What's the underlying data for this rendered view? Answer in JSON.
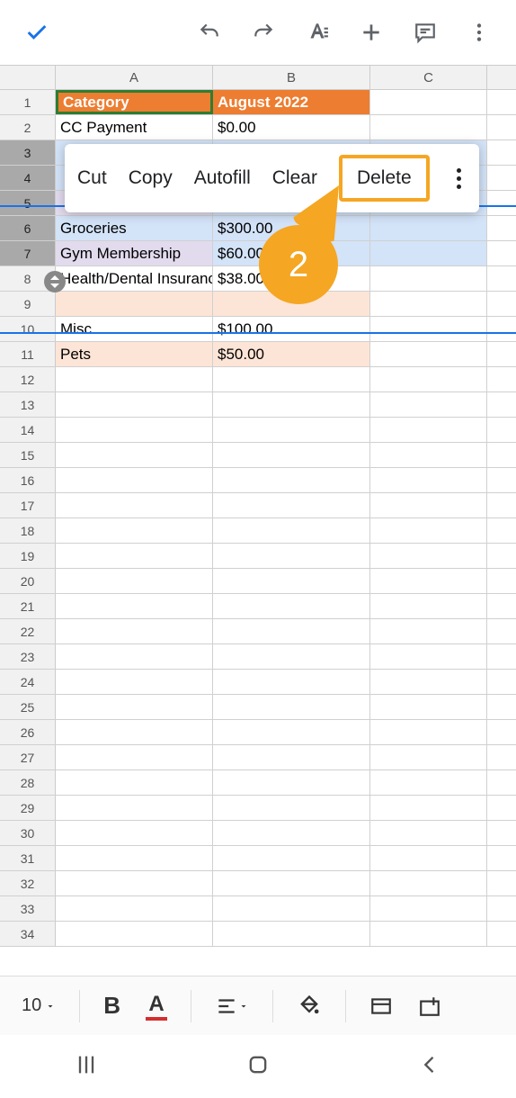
{
  "toolbar": {},
  "columns": [
    "A",
    "B",
    "C"
  ],
  "context_menu": {
    "cut": "Cut",
    "copy": "Copy",
    "autofill": "Autofill",
    "clear": "Clear",
    "delete": "Delete"
  },
  "callout": {
    "number": "2"
  },
  "rows": [
    {
      "n": "1",
      "a": "Category",
      "b": "August 2022",
      "c": "",
      "aCls": "hdr-cell first",
      "bCls": "hdr-cell",
      "cCls": ""
    },
    {
      "n": "2",
      "a": "CC Payment",
      "b": "$0.00",
      "c": "",
      "aCls": "",
      "bCls": "",
      "cCls": ""
    },
    {
      "n": "3",
      "a": "",
      "b": "",
      "c": "",
      "aCls": "blue-sel",
      "bCls": "blue-sel",
      "cCls": "blue-sel",
      "hSel": true
    },
    {
      "n": "4",
      "a": "",
      "b": "",
      "c": "",
      "aCls": "blue-sel",
      "bCls": "blue-sel",
      "cCls": "blue-sel",
      "hSel": true
    },
    {
      "n": "5",
      "a": "",
      "b": "",
      "c": "",
      "aCls": "lav",
      "bCls": "blue-sel",
      "cCls": "blue-sel",
      "hSel": true
    },
    {
      "n": "6",
      "a": "Groceries",
      "b": "$300.00",
      "c": "",
      "aCls": "blue-sel",
      "bCls": "blue-sel",
      "cCls": "blue-sel",
      "hSel": true
    },
    {
      "n": "7",
      "a": "Gym Membership",
      "b": "$60.00",
      "c": "",
      "aCls": "lav",
      "bCls": "blue-sel",
      "cCls": "blue-sel",
      "hSel": true
    },
    {
      "n": "8",
      "a": "Health/Dental Insuranc",
      "b": "$38.00",
      "c": "",
      "aCls": "",
      "bCls": "",
      "cCls": ""
    },
    {
      "n": "9",
      "a": "",
      "b": "",
      "c": "",
      "aCls": "peach",
      "bCls": "peach",
      "cCls": ""
    },
    {
      "n": "10",
      "a": "Misc",
      "b": "$100.00",
      "c": "",
      "aCls": "",
      "bCls": "",
      "cCls": ""
    },
    {
      "n": "11",
      "a": "Pets",
      "b": "$50.00",
      "c": "",
      "aCls": "peach",
      "bCls": "peach",
      "cCls": ""
    },
    {
      "n": "12",
      "a": "",
      "b": "",
      "c": ""
    },
    {
      "n": "13",
      "a": "",
      "b": "",
      "c": ""
    },
    {
      "n": "14",
      "a": "",
      "b": "",
      "c": ""
    },
    {
      "n": "15",
      "a": "",
      "b": "",
      "c": ""
    },
    {
      "n": "16",
      "a": "",
      "b": "",
      "c": ""
    },
    {
      "n": "17",
      "a": "",
      "b": "",
      "c": ""
    },
    {
      "n": "18",
      "a": "",
      "b": "",
      "c": ""
    },
    {
      "n": "19",
      "a": "",
      "b": "",
      "c": ""
    },
    {
      "n": "20",
      "a": "",
      "b": "",
      "c": ""
    },
    {
      "n": "21",
      "a": "",
      "b": "",
      "c": ""
    },
    {
      "n": "22",
      "a": "",
      "b": "",
      "c": ""
    },
    {
      "n": "23",
      "a": "",
      "b": "",
      "c": ""
    },
    {
      "n": "24",
      "a": "",
      "b": "",
      "c": ""
    },
    {
      "n": "25",
      "a": "",
      "b": "",
      "c": ""
    },
    {
      "n": "26",
      "a": "",
      "b": "",
      "c": ""
    },
    {
      "n": "27",
      "a": "",
      "b": "",
      "c": ""
    },
    {
      "n": "28",
      "a": "",
      "b": "",
      "c": ""
    },
    {
      "n": "29",
      "a": "",
      "b": "",
      "c": ""
    },
    {
      "n": "30",
      "a": "",
      "b": "",
      "c": ""
    },
    {
      "n": "31",
      "a": "",
      "b": "",
      "c": ""
    },
    {
      "n": "32",
      "a": "",
      "b": "",
      "c": ""
    },
    {
      "n": "33",
      "a": "",
      "b": "",
      "c": ""
    },
    {
      "n": "34",
      "a": "",
      "b": "",
      "c": ""
    }
  ],
  "bottom": {
    "font_size": "10"
  }
}
